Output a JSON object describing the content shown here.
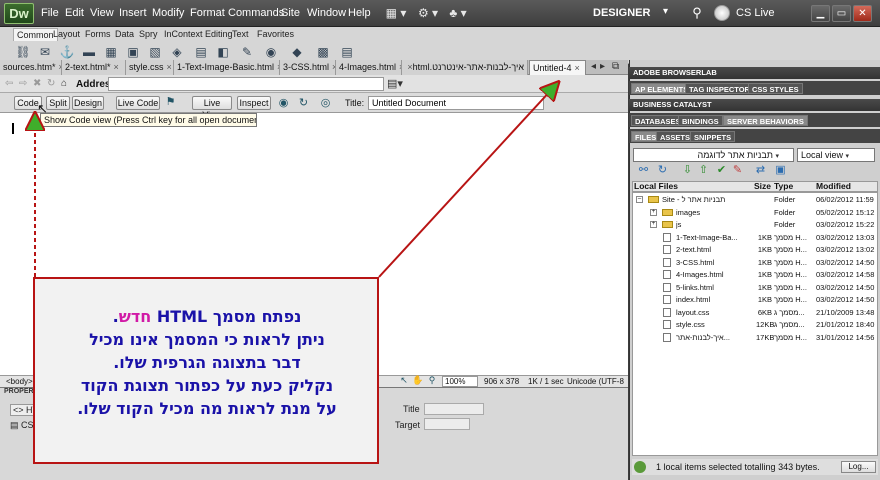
{
  "app": {
    "logo": "Dw"
  },
  "menu": {
    "items": [
      "File",
      "Edit",
      "View",
      "Insert",
      "Modify",
      "Format",
      "Commands",
      "Site",
      "Window",
      "Help"
    ],
    "icons": [
      "layout-icon",
      "gear-icon",
      "site-icon"
    ],
    "workspace": "DESIGNER",
    "cslive": "CS Live",
    "window_buttons": [
      "minimize-icon",
      "maximize-icon",
      "close-icon"
    ]
  },
  "insert_bar": {
    "tabs": [
      "Common",
      "Layout",
      "Forms",
      "Data",
      "Spry",
      "InContext Editing",
      "Text",
      "Favorites"
    ],
    "active_tab": "Common",
    "buttons": [
      "link-icon",
      "email-link-icon",
      "named-anchor-icon",
      "horizontal-rule-icon",
      "table-icon",
      "div-icon",
      "image-icon",
      "media-icon",
      "date-icon",
      "server-include-icon",
      "comment-icon",
      "head-icon",
      "script-icon",
      "templates-icon",
      "tag-chooser-icon"
    ]
  },
  "doc_tabs": {
    "tabs": [
      "sources.htm*",
      "2-text.html*",
      "style.css",
      "1-Text-Image-Basic.html",
      "3-CSS.html",
      "4-Images.html",
      "איך-לבנות-אתר-אינטרנט.html",
      "Untitled-4"
    ],
    "active": "Untitled-4",
    "close_glyph": "×"
  },
  "address_bar": {
    "label": "Address:",
    "value": ""
  },
  "doc_toolbar": {
    "code": "Code",
    "split": "Split",
    "design": "Design",
    "live_code": "Live Code",
    "live_view": "Live View",
    "inspect": "Inspect",
    "title_label": "Title:",
    "title_value": "Untitled Document"
  },
  "tooltip": "Show Code view (Press Ctrl key for all open documents)",
  "status_bar": {
    "tag": "<body>",
    "zoom": "100%",
    "size": "906 x 378",
    "download": "1K / 1 sec",
    "encoding": "Unicode (UTF-8"
  },
  "properties": {
    "title": "PROPERTIES",
    "html_button": "HTML",
    "css_button": "CSS",
    "title_label": "Title",
    "target_label": "Target"
  },
  "right_panel": {
    "browserlab": "ADOBE BROWSERLAB",
    "group1_tabs": [
      "AP ELEMENTS",
      "TAG INSPECTOR",
      "CSS STYLES"
    ],
    "business_catalyst": "BUSINESS CATALYST",
    "group2_tabs": [
      "DATABASES",
      "BINDINGS",
      "SERVER BEHAVIORS"
    ],
    "group3_tabs": [
      "FILES",
      "ASSETS",
      "SNIPPETS"
    ],
    "site_select": "תבניות אתר לדוגמה",
    "view_select": "Local view",
    "file_toolbar": [
      "connect-icon",
      "refresh-icon",
      "get-icon",
      "put-icon",
      "check-out-icon",
      "check-in-icon",
      "synchronize-icon",
      "expand-icon"
    ],
    "columns": {
      "name": "Local Files",
      "size": "Size",
      "type": "Type",
      "modified": "Modified"
    },
    "files": [
      {
        "name": "Site - תבניות אתר ל",
        "size": "",
        "type": "Folder",
        "modified": "06/02/2012 11:59",
        "kind": "root"
      },
      {
        "name": "images",
        "size": "",
        "type": "Folder",
        "modified": "05/02/2012 15:12",
        "kind": "folder"
      },
      {
        "name": "js",
        "size": "",
        "type": "Folder",
        "modified": "03/02/2012 15:22",
        "kind": "folder"
      },
      {
        "name": "1-Text-Image-Ba...",
        "size": "1KB",
        "type": "מסמך H...",
        "modified": "03/02/2012 13:03",
        "kind": "file"
      },
      {
        "name": "2-text.html",
        "size": "1KB",
        "type": "מסמך H...",
        "modified": "03/02/2012 13:02",
        "kind": "file"
      },
      {
        "name": "3-CSS.html",
        "size": "1KB",
        "type": "מסמך H...",
        "modified": "03/02/2012 14:50",
        "kind": "file"
      },
      {
        "name": "4-Images.html",
        "size": "1KB",
        "type": "מסמך H...",
        "modified": "03/02/2012 14:58",
        "kind": "file"
      },
      {
        "name": "5-links.html",
        "size": "1KB",
        "type": "מסמך H...",
        "modified": "03/02/2012 14:50",
        "kind": "file"
      },
      {
        "name": "index.html",
        "size": "1KB",
        "type": "מסמך H...",
        "modified": "03/02/2012 14:50",
        "kind": "file"
      },
      {
        "name": "layout.css",
        "size": "6KB",
        "type": "מסמך ג...",
        "modified": "21/10/2009 13:48",
        "kind": "file"
      },
      {
        "name": "style.css",
        "size": "12KB",
        "type": "מסמך ג...",
        "modified": "21/01/2012 18:40",
        "kind": "file"
      },
      {
        "name": "איך-לבנות-אתר...",
        "size": "17KB",
        "type": "מסמך H...",
        "modified": "31/01/2012 14:56",
        "kind": "file"
      }
    ],
    "status": "1 local items selected totalling 343 bytes.",
    "log_button": "Log..."
  },
  "callout": {
    "line1_prefix": "נפתח מסמך HTML",
    "line1_new": "חדש",
    "line1_suffix": ".",
    "line2": "ניתן לראות כי המסמך אינו מכיל",
    "line3": "דבר בתצוגה הגרפית שלו.",
    "line4": "נקליק כעת על כפתור תצוגת הקוד",
    "line5": "על מנת לראות מה מכיל הקוד שלו.",
    "border_color": "#b81414",
    "text_color": "#1a12a8",
    "highlight_color": "#d11aa6"
  }
}
